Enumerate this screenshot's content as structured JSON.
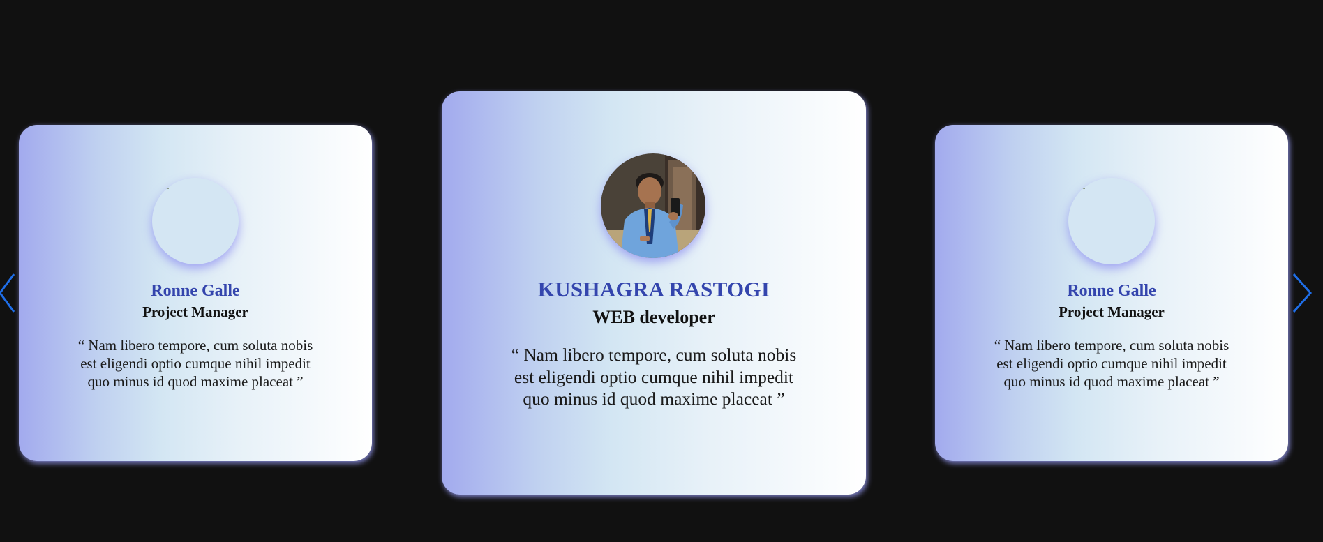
{
  "carousel": {
    "prev_icon": "chevron-left-icon",
    "next_icon": "chevron-right-icon",
    "accent_color": "#1f6ee8",
    "cards": [
      {
        "name": "Ronne Galle",
        "role": "Project Manager",
        "quote": "“ Nam libero tempore, cum soluta nobis est eligendi optio cumque nihil impedit quo minus id quod maxime placeat ”",
        "avatar_state": "broken-image"
      },
      {
        "name": "KUSHAGRA RASTOGI",
        "role": "WEB developer",
        "quote": "“ Nam libero tempore, cum soluta nobis est eligendi optio cumque nihil impedit quo minus id quod maxime placeat ”",
        "avatar_state": "photo"
      },
      {
        "name": "Ronne Galle",
        "role": "Project Manager",
        "quote": "“ Nam libero tempore, cum soluta nobis est eligendi optio cumque nihil impedit quo minus id quod maxime placeat ”",
        "avatar_state": "broken-image"
      }
    ]
  },
  "colors": {
    "background": "#111111",
    "name": "#3445ad",
    "role": "#111111"
  }
}
